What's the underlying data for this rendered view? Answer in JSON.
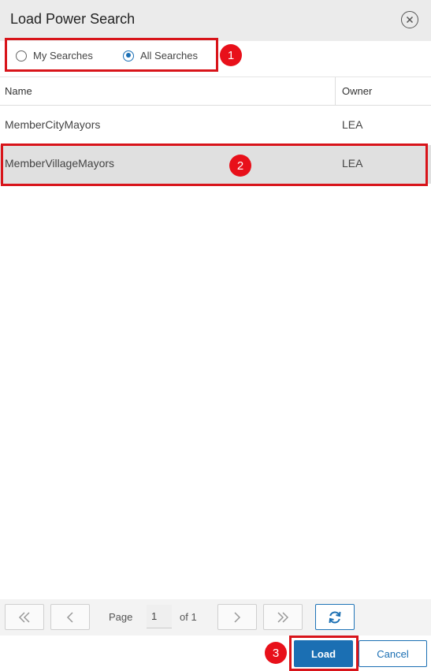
{
  "dialog": {
    "title": "Load Power Search",
    "close_icon": "close-circle-icon"
  },
  "filter": {
    "options": [
      {
        "label": "My Searches",
        "checked": false
      },
      {
        "label": "All Searches",
        "checked": true
      }
    ]
  },
  "grid": {
    "columns": [
      "Name",
      "Owner"
    ],
    "rows": [
      {
        "name": "MemberCityMayors",
        "owner": "LEA",
        "selected": false
      },
      {
        "name": "MemberVillageMayors",
        "owner": "LEA",
        "selected": true
      }
    ]
  },
  "pager": {
    "page_label": "Page",
    "page_value": "1",
    "of_label": "of 1",
    "icons": [
      "first-page-icon",
      "prev-page-icon",
      "next-page-icon",
      "last-page-icon",
      "refresh-icon"
    ]
  },
  "actions": {
    "load_label": "Load",
    "cancel_label": "Cancel"
  },
  "annotations": {
    "markers": [
      "1",
      "2",
      "3"
    ],
    "highlight_color": "#d8141a"
  },
  "colors": {
    "accent": "#1b6fb3",
    "marker": "#e8101a",
    "selected_row": "#e0e0e0"
  }
}
